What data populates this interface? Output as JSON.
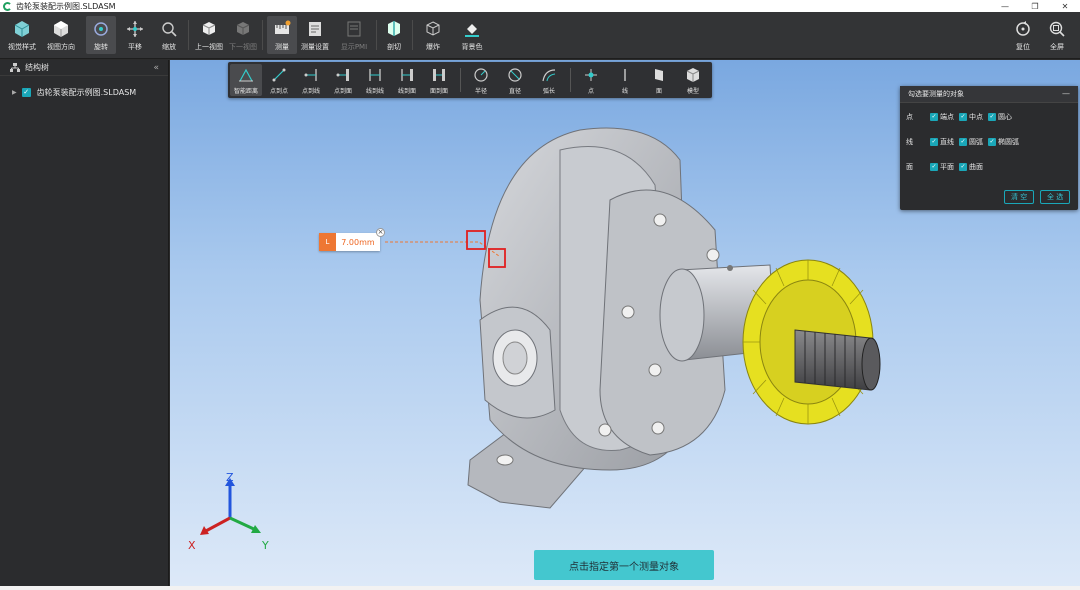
{
  "window": {
    "title": "齿轮泵装配示例图.SLDASM",
    "controls": [
      "minimize",
      "restore",
      "close"
    ]
  },
  "toolbar": {
    "items": [
      {
        "label": "视觉样式",
        "icon": "cube-style-icon"
      },
      {
        "label": "视图方向",
        "icon": "view-cube-icon"
      },
      {
        "label": "旋转",
        "icon": "rotate-icon",
        "active": true
      },
      {
        "label": "平移",
        "icon": "pan-icon"
      },
      {
        "label": "缩放",
        "icon": "zoom-icon"
      },
      {
        "label": "上一视图",
        "icon": "prev-view-icon"
      },
      {
        "label": "下一视图",
        "icon": "next-view-icon",
        "disabled": true
      },
      {
        "label": "测量",
        "icon": "measure-icon",
        "active": true
      },
      {
        "label": "测量设置",
        "icon": "measure-settings-icon"
      },
      {
        "label": "显示PMI",
        "icon": "pmi-icon",
        "disabled": true
      },
      {
        "label": "剖切",
        "icon": "section-icon"
      },
      {
        "label": "爆炸",
        "icon": "explode-icon"
      },
      {
        "label": "背景色",
        "icon": "bg-color-icon"
      },
      {
        "label": "复位",
        "icon": "reset-icon"
      },
      {
        "label": "全屏",
        "icon": "fullscreen-icon"
      }
    ]
  },
  "sidebar": {
    "title": "结构树",
    "collapse_glyph": "«",
    "tree": [
      {
        "label": "齿轮泵装配示例图.SLDASM",
        "checked": true
      }
    ]
  },
  "measure_bar": {
    "items": [
      {
        "label": "智能距离",
        "active": true
      },
      {
        "label": "点到点"
      },
      {
        "label": "点到线"
      },
      {
        "label": "点到面"
      },
      {
        "label": "线到线"
      },
      {
        "label": "线到面"
      },
      {
        "label": "面到面"
      },
      {
        "label": "半径"
      },
      {
        "label": "直径"
      },
      {
        "label": "弧长"
      },
      {
        "label": "点"
      },
      {
        "label": "线"
      },
      {
        "label": "面"
      },
      {
        "label": "模型"
      }
    ]
  },
  "filter_panel": {
    "title": "勾选要测量的对象",
    "minimize_glyph": "—",
    "rows": [
      {
        "category": "点",
        "options": [
          "端点",
          "中点",
          "圆心"
        ]
      },
      {
        "category": "线",
        "options": [
          "直线",
          "圆弧",
          "椭圆弧"
        ]
      },
      {
        "category": "面",
        "options": [
          "平面",
          "曲面"
        ]
      }
    ],
    "clear_label": "清 空",
    "select_all_label": "全 选"
  },
  "measurement": {
    "tag": "L",
    "value": "7.00mm",
    "close_glyph": "×"
  },
  "hint": {
    "text": "点击指定第一个测量对象"
  },
  "triad": {
    "x_label": "X",
    "y_label": "Y",
    "z_label": "Z"
  },
  "colors": {
    "accent": "#1aa7b8",
    "measure_orange": "#ee7733",
    "hint_bg": "#44c7cf",
    "gear_yellow": "#e6e020",
    "model_gray": "#b9bcc2",
    "selection_red": "#e02020"
  }
}
